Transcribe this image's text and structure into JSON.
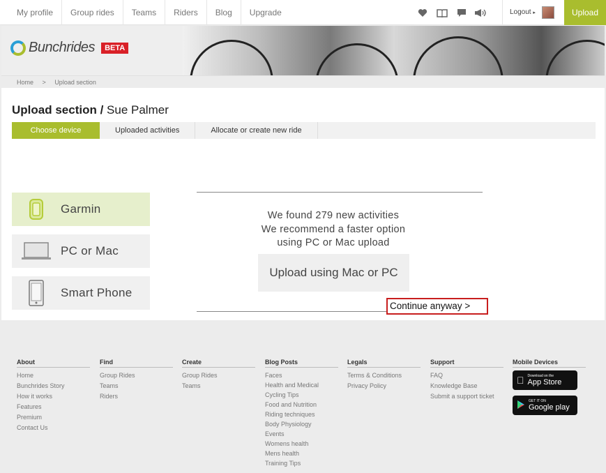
{
  "nav": {
    "links": [
      "My profile",
      "Group rides",
      "Teams",
      "Riders",
      "Blog",
      "Upgrade"
    ],
    "icons": [
      "heart-icon",
      "book-icon",
      "chat-icon",
      "megaphone-icon"
    ],
    "logout": "Logout",
    "upload": "Upload"
  },
  "brand": {
    "name": "Bunchrides",
    "badge": "BETA"
  },
  "breadcrumb": [
    "Home",
    ">",
    "Upload section"
  ],
  "page": {
    "title_bold": "Upload section",
    "title_sep": " / ",
    "user": "Sue Palmer"
  },
  "tabs": [
    "Choose device",
    "Uploaded activities",
    "Allocate or create new ride"
  ],
  "devices": [
    "Garmin",
    "PC or Mac",
    "Smart Phone"
  ],
  "message": {
    "line1": "We found 279 new activities",
    "line2": "We recommend a faster option",
    "line3": "using PC or Mac upload",
    "button": "Upload using Mac or PC",
    "continue": "Continue anyway >"
  },
  "footer": {
    "about": {
      "title": "About",
      "links": [
        "Home",
        "Bunchrides Story",
        "How it works",
        "Features",
        "Premium",
        "Contact Us"
      ]
    },
    "find": {
      "title": "Find",
      "links": [
        "Group Rides",
        "Teams",
        "Riders"
      ]
    },
    "create": {
      "title": "Create",
      "links": [
        "Group Rides",
        "Teams"
      ]
    },
    "blog": {
      "title": "Blog Posts",
      "links": [
        "Faces",
        "Health and Medical",
        "Cycling Tips",
        "Food and Nutrition",
        "Riding techniques",
        "Body Physiology",
        "Events",
        "Womens health",
        "Mens health",
        "Training Tips"
      ]
    },
    "legals": {
      "title": "Legals",
      "links": [
        "Terms & Conditions",
        "Privacy Policy"
      ]
    },
    "support": {
      "title": "Support",
      "links": [
        "FAQ",
        "Knowledge Base",
        "Submit a support ticket"
      ]
    },
    "mobile": {
      "title": "Mobile Devices",
      "appstore_small": "Download on the",
      "appstore": "App Store",
      "googleplay_small": "GET IT ON",
      "googleplay": "Google play"
    }
  },
  "colors": {
    "accent": "#a9bd2e",
    "beta": "#d92027",
    "highlight": "#c81e1e"
  }
}
